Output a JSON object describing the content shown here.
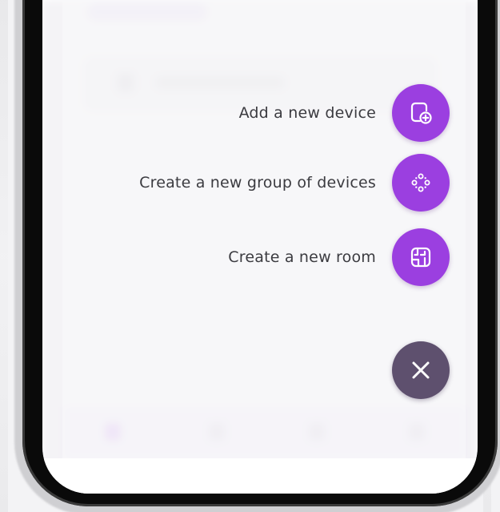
{
  "fab_menu": {
    "items": [
      {
        "label": "Add a new device",
        "icon": "add-device-icon"
      },
      {
        "label": "Create a new group of devices",
        "icon": "device-group-icon"
      },
      {
        "label": "Create a new room",
        "icon": "room-layout-icon"
      }
    ],
    "close_icon": "close-icon"
  },
  "colors": {
    "accent": "#9b3fe0",
    "close_button": "#5e506e",
    "label_text": "#3b3b40",
    "scrim": "#f8f8fa"
  }
}
